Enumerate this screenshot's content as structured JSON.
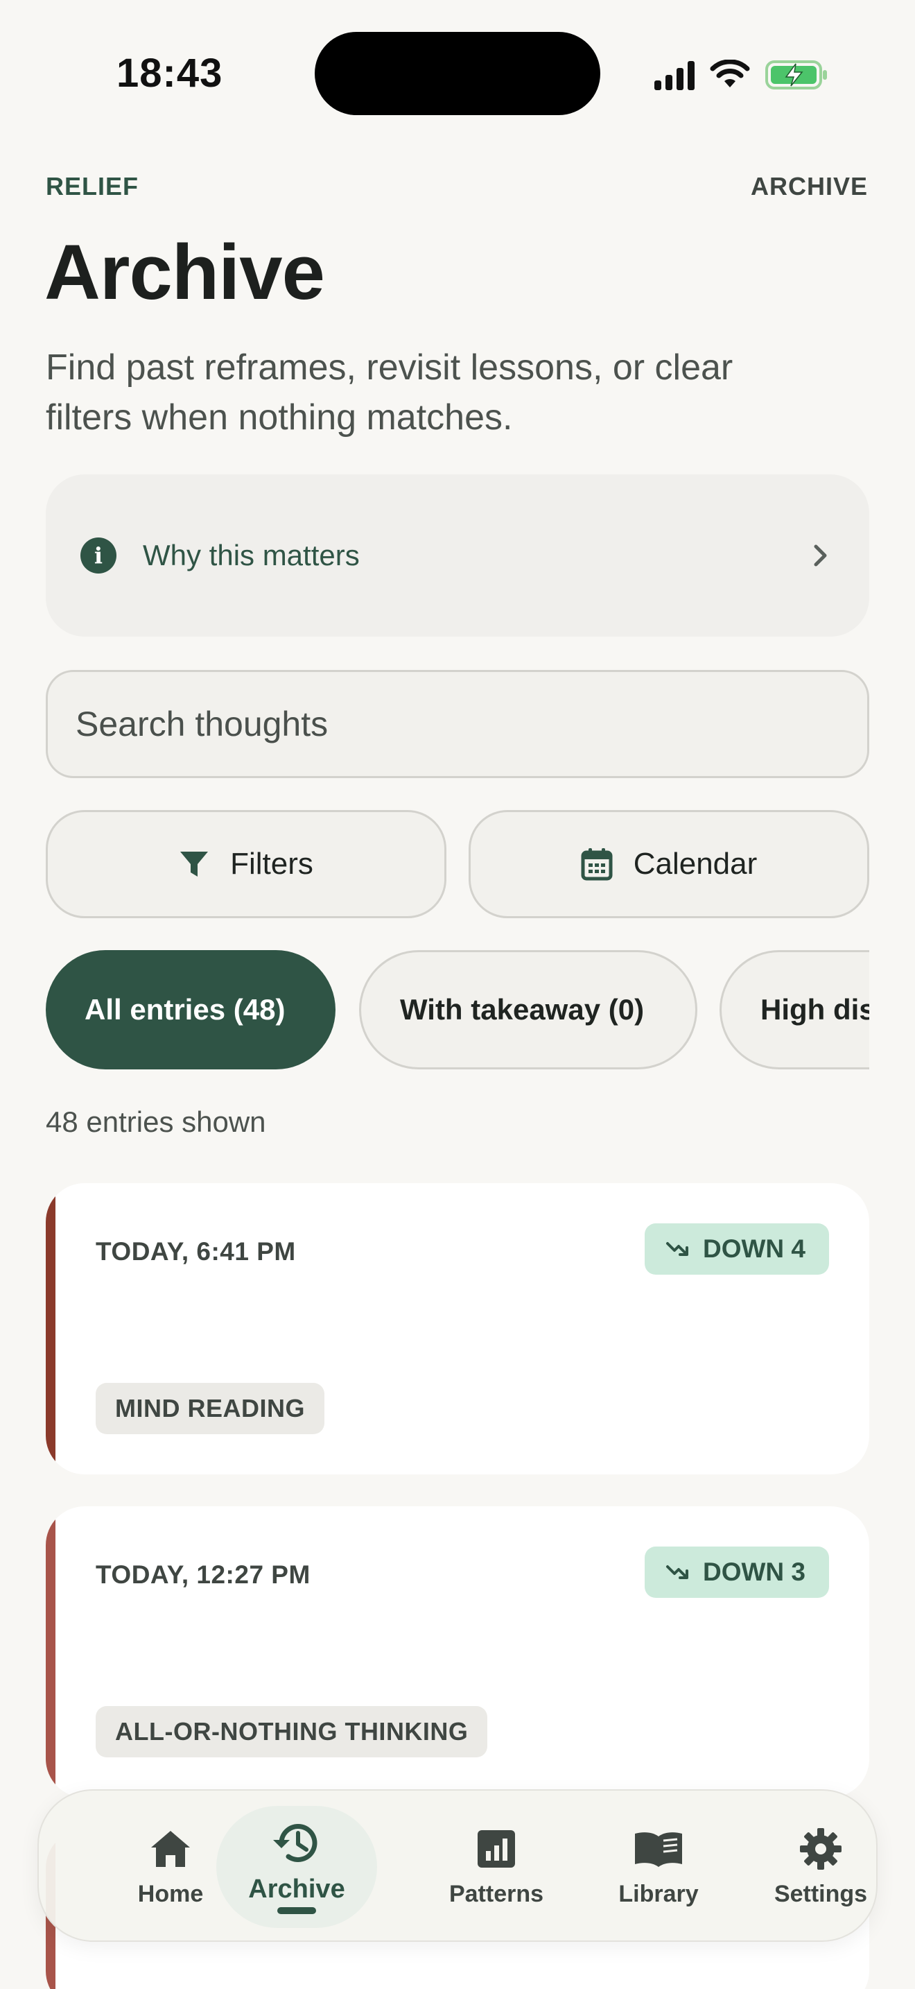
{
  "status": {
    "time": "18:43"
  },
  "header": {
    "brand": "RELIEF",
    "section": "ARCHIVE",
    "title": "Archive",
    "subtitle": "Find past reframes, revisit lessons, or clear filters when nothing matches."
  },
  "why_card": {
    "label": "Why this matters",
    "icon": "info-icon"
  },
  "search": {
    "placeholder": "Search thoughts",
    "value": ""
  },
  "buttons": {
    "filters": "Filters",
    "calendar": "Calendar"
  },
  "chips": [
    {
      "label": "All entries (48)",
      "active": true
    },
    {
      "label": "With takeaway (0)",
      "active": false
    },
    {
      "label": "High distress",
      "active": false
    }
  ],
  "entries_count": "48 entries shown",
  "entries": [
    {
      "date": "TODAY, 6:41 PM",
      "trend": "DOWN 4",
      "tag": "MIND READING",
      "accent": "#8b3a2b"
    },
    {
      "date": "TODAY, 12:27 PM",
      "trend": "DOWN 3",
      "tag": "ALL-OR-NOTHING THINKING",
      "accent": "#a8544a"
    }
  ],
  "nav": {
    "home": "Home",
    "archive": "Archive",
    "patterns": "Patterns",
    "library": "Library",
    "settings": "Settings",
    "active": "archive"
  },
  "colors": {
    "accent": "#2f5445",
    "background": "#f8f7f4",
    "trend_bg": "#cceadb"
  }
}
